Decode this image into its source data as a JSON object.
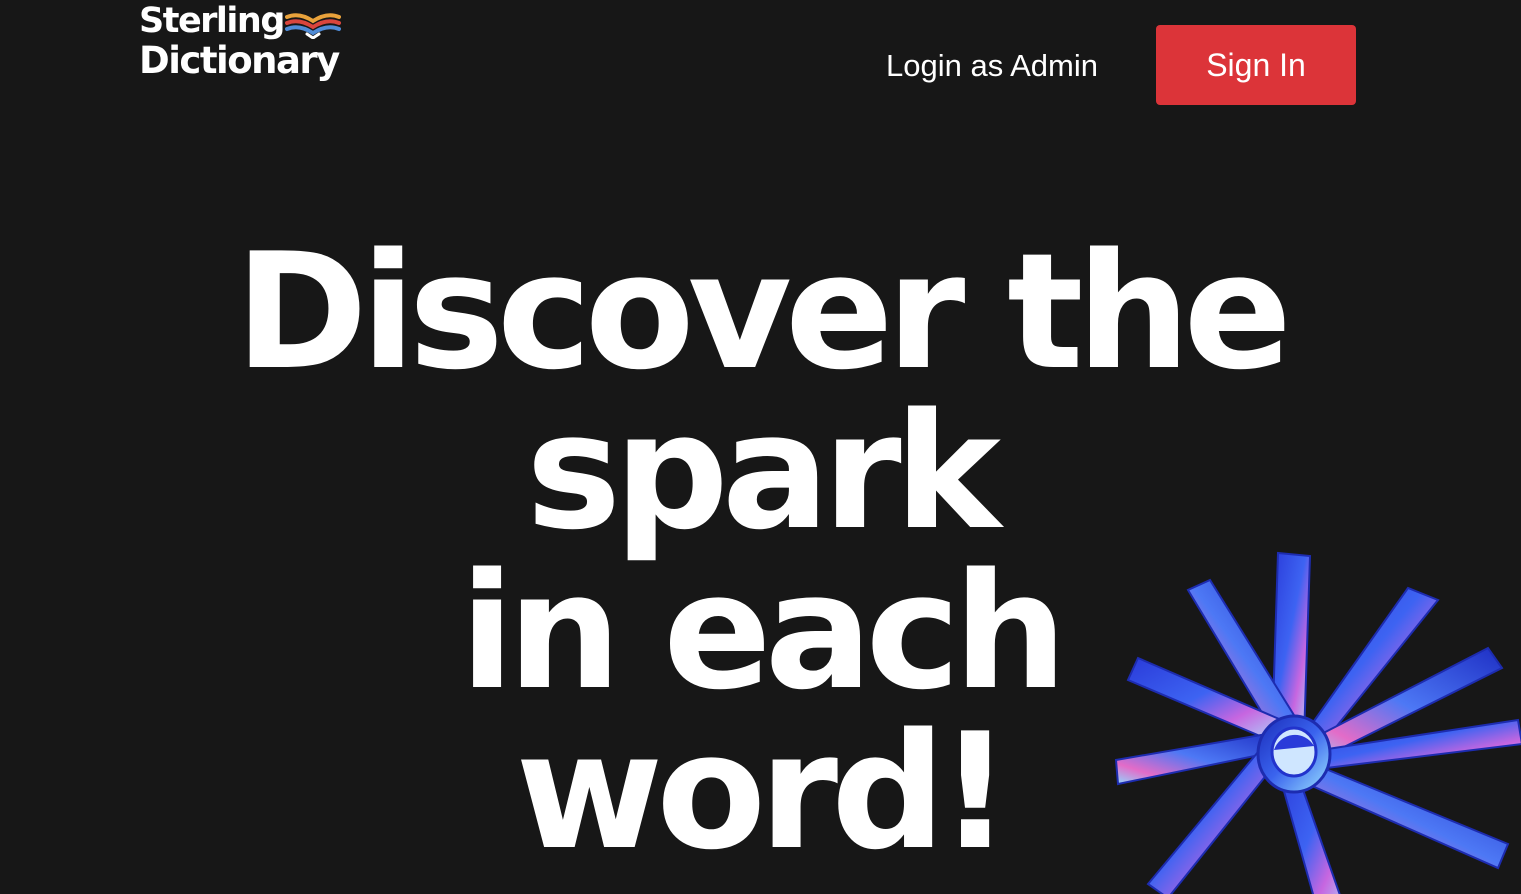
{
  "brand": {
    "line1": "Sterling",
    "line2": "Dictionary",
    "book_colors": [
      "#e9a23b",
      "#d9453d",
      "#4f8bd6",
      "#ffffff"
    ]
  },
  "nav": {
    "admin_login_label": "Login as Admin",
    "sign_in_label": "Sign In",
    "sign_in_color": "#dc3439"
  },
  "hero": {
    "line1": "Discover the",
    "line2": "spark",
    "line3": "in each",
    "line4": "word!"
  },
  "decoration": {
    "icon": "starburst-3d-icon",
    "colors": [
      "#2233cc",
      "#3b6cf0",
      "#e060d0",
      "#9fe0ff"
    ]
  }
}
